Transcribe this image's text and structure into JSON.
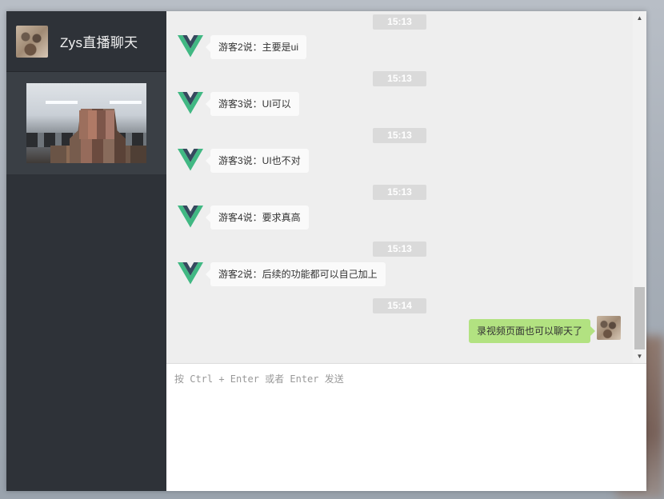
{
  "sidebar": {
    "title": "Zys直播聊天",
    "avatar_icon": "user-avatar",
    "video_thumbnail": "live-video-thumbnail"
  },
  "chat": {
    "messages": [
      {
        "time": "15:13",
        "text": "游客2说：主要是ui",
        "self": false,
        "avatar_icon": "vue-logo-icon"
      },
      {
        "time": "15:13",
        "text": "游客3说：UI可以",
        "self": false,
        "avatar_icon": "vue-logo-icon"
      },
      {
        "time": "15:13",
        "text": "游客3说：UI也不对",
        "self": false,
        "avatar_icon": "vue-logo-icon"
      },
      {
        "time": "15:13",
        "text": "游客4说：要求真高",
        "self": false,
        "avatar_icon": "vue-logo-icon"
      },
      {
        "time": "15:13",
        "text": "游客2说：后续的功能都可以自己加上",
        "self": false,
        "avatar_icon": "vue-logo-icon"
      },
      {
        "time": "15:14",
        "text": "录视频页面也可以聊天了",
        "self": true,
        "avatar_icon": "user-avatar"
      }
    ]
  },
  "composer": {
    "placeholder": "按 Ctrl + Enter 或者 Enter 发送",
    "value": ""
  },
  "colors": {
    "sidebar_bg": "#2e3238",
    "chat_bg": "#eeeeee",
    "self_bubble": "#b2e281",
    "other_bubble": "#fafafa",
    "time_badge": "#dadada",
    "vue_green": "#41b883",
    "vue_dark": "#35495e"
  }
}
